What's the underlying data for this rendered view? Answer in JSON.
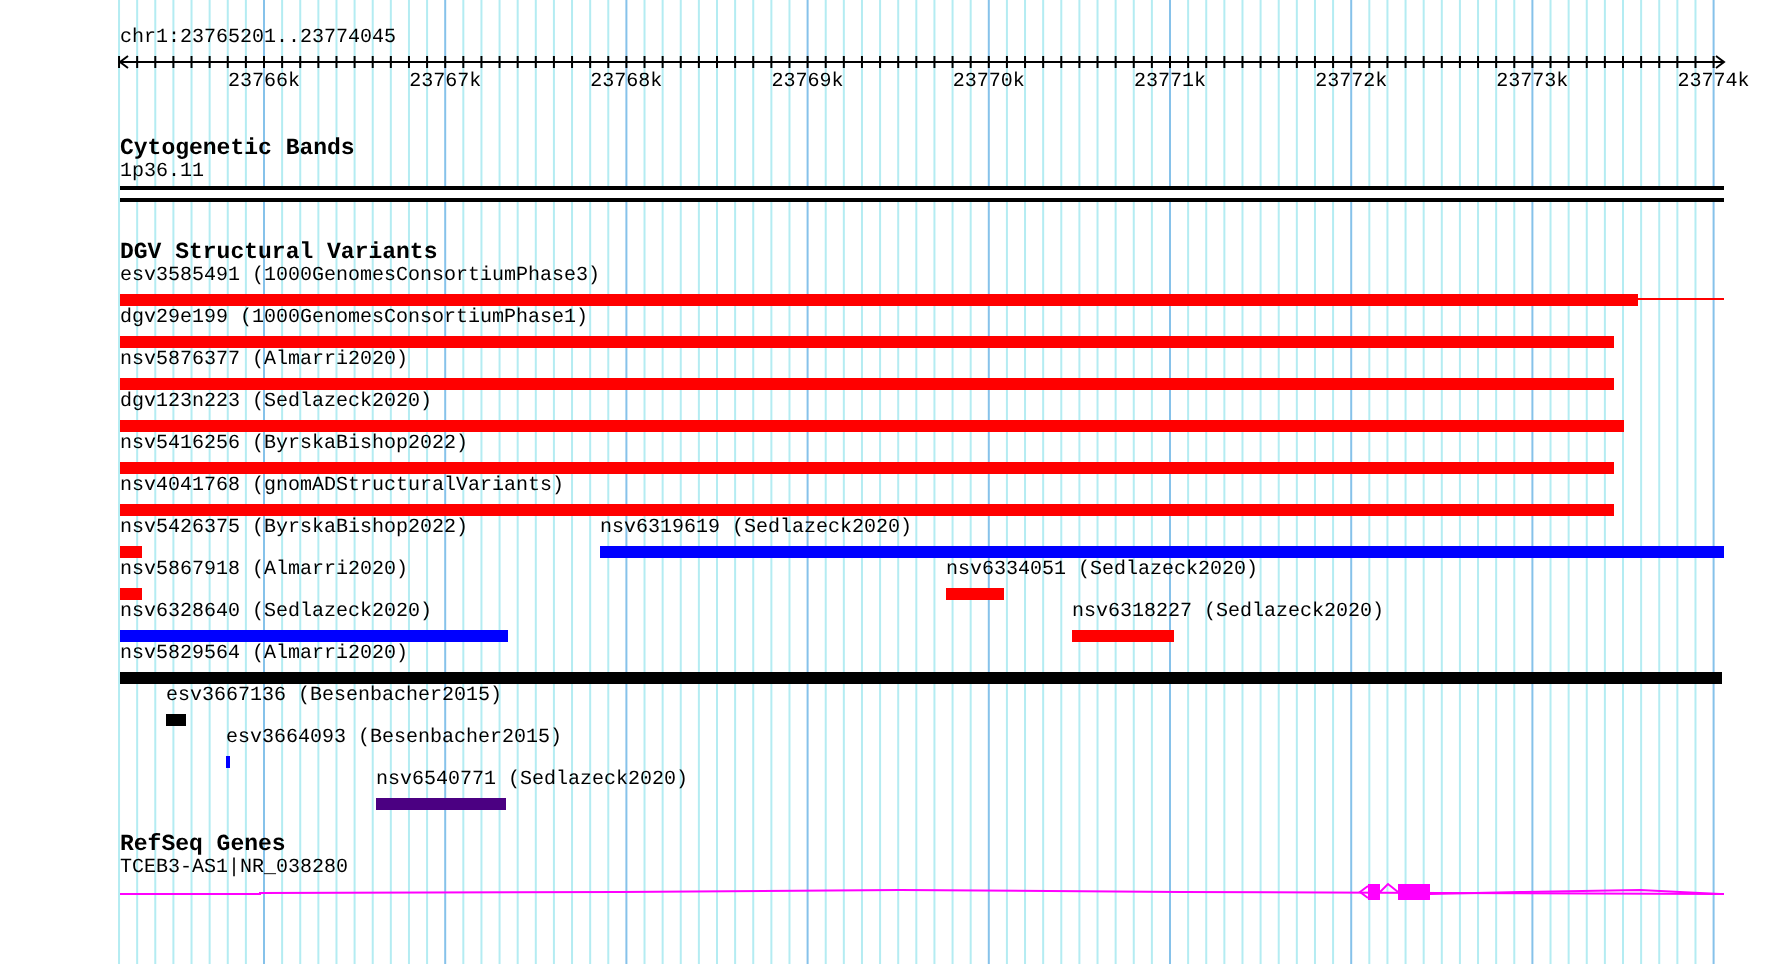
{
  "location": "chr1:23765201..23774045",
  "ruler": {
    "ticks": [
      "23766k",
      "23767k",
      "23768k",
      "23769k",
      "23770k",
      "23771k",
      "23772k",
      "23773k",
      "23774k"
    ]
  },
  "tracks": [
    {
      "kind": "cytoband",
      "title": "Cytogenetic Bands",
      "band": "1p36.11"
    },
    {
      "kind": "variants",
      "title": "DGV Structural Variants",
      "rows": [
        {
          "features": [
            {
              "label": "esv3585491 (1000GenomesConsortiumPhase3)",
              "color": "#ff0000"
            }
          ]
        },
        {
          "features": [
            {
              "label": "dgv29e199 (1000GenomesConsortiumPhase1)",
              "color": "#ff0000"
            }
          ]
        },
        {
          "features": [
            {
              "label": "nsv5876377 (Almarri2020)",
              "color": "#ff0000"
            }
          ]
        },
        {
          "features": [
            {
              "label": "dgv123n223 (Sedlazeck2020)",
              "color": "#ff0000"
            }
          ]
        },
        {
          "features": [
            {
              "label": "nsv5416256 (ByrskaBishop2022)",
              "color": "#ff0000"
            }
          ]
        },
        {
          "features": [
            {
              "label": "nsv4041768 (gnomADStructuralVariants)",
              "color": "#ff0000"
            }
          ]
        },
        {
          "features": [
            {
              "label": "nsv5426375 (ByrskaBishop2022)",
              "color": "#ff0000"
            },
            {
              "label": "nsv6319619 (Sedlazeck2020)",
              "color": "#0000ff"
            }
          ]
        },
        {
          "features": [
            {
              "label": "nsv5867918 (Almarri2020)",
              "color": "#ff0000"
            },
            {
              "label": "nsv6334051 (Sedlazeck2020)",
              "color": "#ff0000"
            }
          ]
        },
        {
          "features": [
            {
              "label": "nsv6328640 (Sedlazeck2020)",
              "color": "#0000ff"
            },
            {
              "label": "nsv6318227 (Sedlazeck2020)",
              "color": "#ff0000"
            }
          ]
        },
        {
          "features": [
            {
              "label": "nsv5829564 (Almarri2020)",
              "color": "#000000"
            }
          ]
        },
        {
          "features": [
            {
              "label": "esv3667136 (Besenbacher2015)",
              "color": "#000000"
            }
          ]
        },
        {
          "features": [
            {
              "label": "esv3664093 (Besenbacher2015)",
              "color": "#0000ff"
            }
          ]
        },
        {
          "features": [
            {
              "label": "nsv6540771 (Sedlazeck2020)",
              "color": "#4b0082"
            }
          ]
        }
      ]
    },
    {
      "kind": "genes",
      "title": "RefSeq Genes",
      "gene": "TCEB3-AS1|NR_038280",
      "color": "#ff00ff"
    }
  ]
}
